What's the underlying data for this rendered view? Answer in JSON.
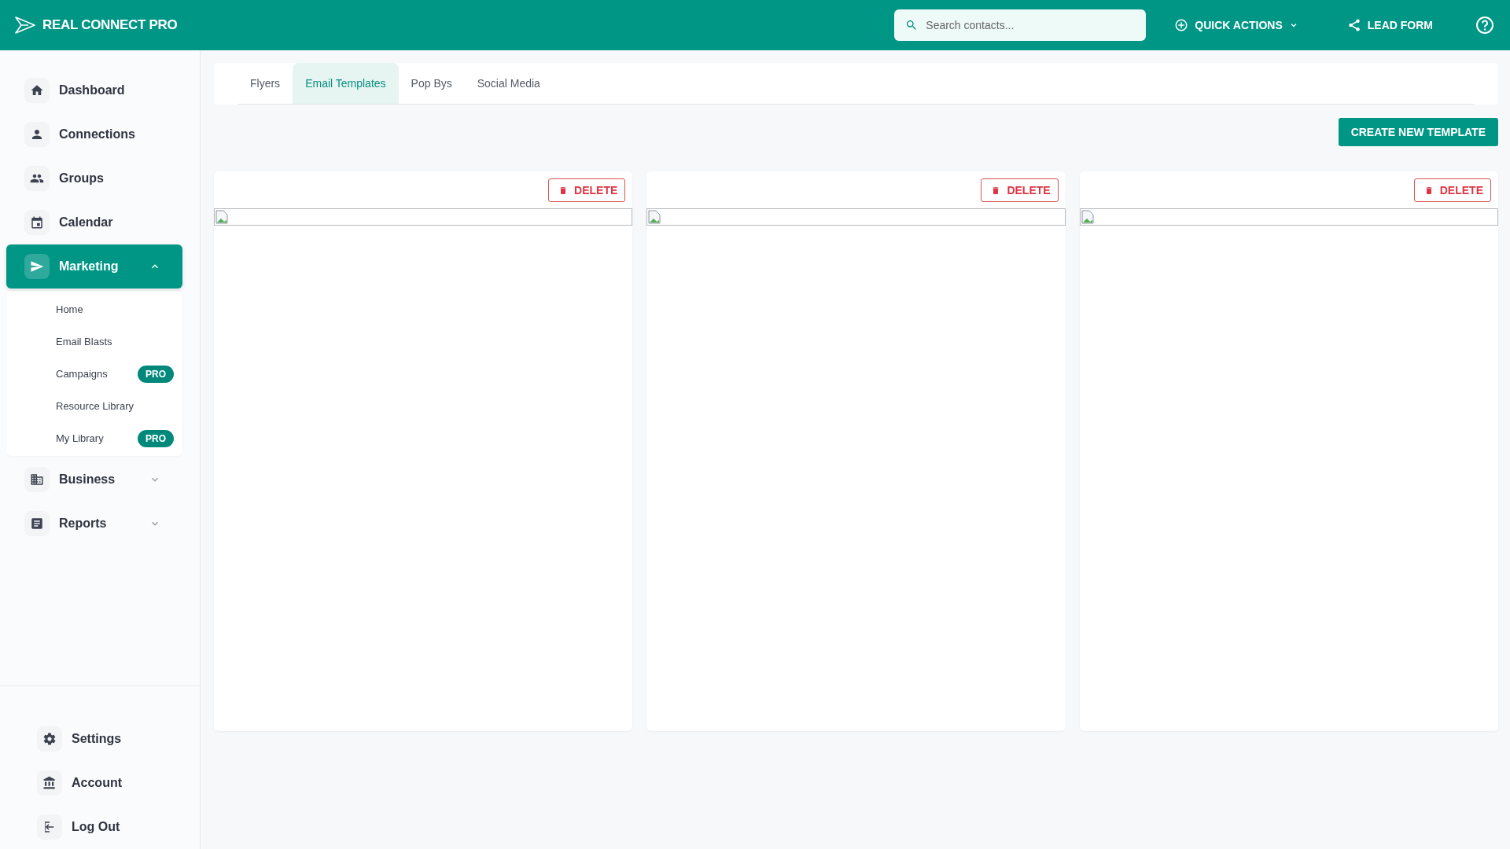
{
  "header": {
    "brand": "REAL CONNECT PRO",
    "search": {
      "placeholder": "Search contacts..."
    },
    "quick_actions": "QUICK ACTIONS",
    "lead_form": "LEAD FORM"
  },
  "sidebar": {
    "items": [
      {
        "label": "Dashboard",
        "kind": "link",
        "selected": false
      },
      {
        "label": "Connections",
        "kind": "link",
        "selected": false
      },
      {
        "label": "Groups",
        "kind": "link",
        "selected": false
      },
      {
        "label": "Calendar",
        "kind": "link",
        "selected": false
      },
      {
        "label": "Marketing",
        "kind": "group",
        "selected": true,
        "expanded": true,
        "children": [
          {
            "label": "Home"
          },
          {
            "label": "Email Blasts"
          },
          {
            "label": "Campaigns",
            "badge": "PRO"
          },
          {
            "label": "Resource Library"
          },
          {
            "label": "My Library",
            "badge": "PRO"
          }
        ]
      },
      {
        "label": "Business",
        "kind": "group",
        "selected": false,
        "expanded": false
      },
      {
        "label": "Reports",
        "kind": "group",
        "selected": false,
        "expanded": false
      }
    ],
    "bottom_items": [
      {
        "label": "Settings"
      },
      {
        "label": "Account"
      },
      {
        "label": "Log Out"
      }
    ]
  },
  "tabs": [
    {
      "label": "Flyers",
      "selected": false
    },
    {
      "label": "Email Templates",
      "selected": true
    },
    {
      "label": "Pop Bys",
      "selected": false
    },
    {
      "label": "Social Media",
      "selected": false
    }
  ],
  "create_button": "CREATE NEW TEMPLATE",
  "cards": [
    {
      "delete": "DELETE"
    },
    {
      "delete": "DELETE"
    },
    {
      "delete": "DELETE"
    }
  ]
}
